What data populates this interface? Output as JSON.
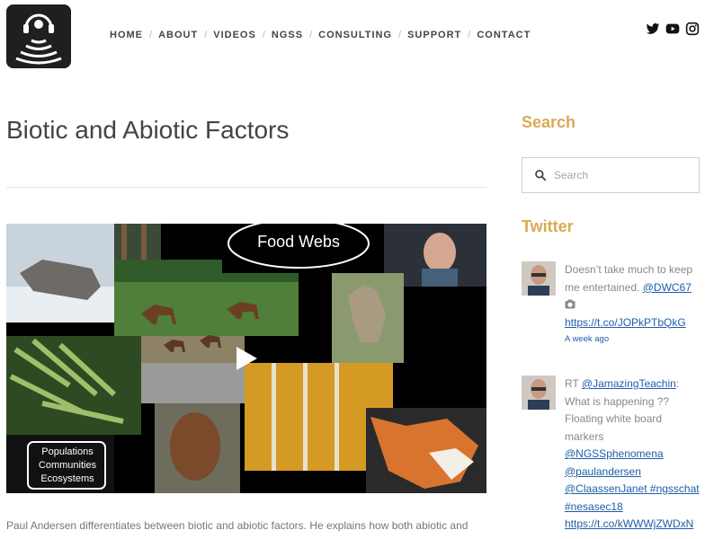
{
  "nav": {
    "items": [
      "HOME",
      "ABOUT",
      "VIDEOS",
      "NGSS",
      "CONSULTING",
      "SUPPORT",
      "CONTACT"
    ],
    "separator": "/"
  },
  "social": {
    "icons": [
      "twitter-icon",
      "youtube-icon",
      "instagram-icon"
    ]
  },
  "post": {
    "title": "Biotic and Abiotic Factors",
    "video_labels": {
      "food_webs": "Food Webs",
      "levels": [
        "Populations",
        "Communities",
        "Ecosystems"
      ]
    },
    "excerpt": "Paul Andersen differentiates between biotic and abiotic factors. He explains how both abiotic and"
  },
  "sidebar": {
    "search_heading": "Search",
    "search_placeholder": "Search",
    "twitter_heading": "Twitter",
    "tweets": [
      {
        "lines": [
          "Doesn’t take much to keep",
          "me entertained. ",
          "@DWC67",
          "https://t.co/JOPkPTbQkG"
        ],
        "time": "A week ago"
      },
      {
        "rt": "RT ",
        "handle": "@JamazingTeachin",
        "colon": ":",
        "plain": [
          "What is happening ??",
          "Floating white board",
          "markers"
        ],
        "links": [
          "@NGSSphenomena",
          "@paulandersen",
          "@ClaassenJanet",
          " #ngsschat",
          "#nesasec18",
          "https://t.co/kWWWjZWDxN"
        ]
      }
    ]
  },
  "colors": {
    "accent": "#d8aa54",
    "link": "#1d5fa8",
    "text": "#777777"
  }
}
